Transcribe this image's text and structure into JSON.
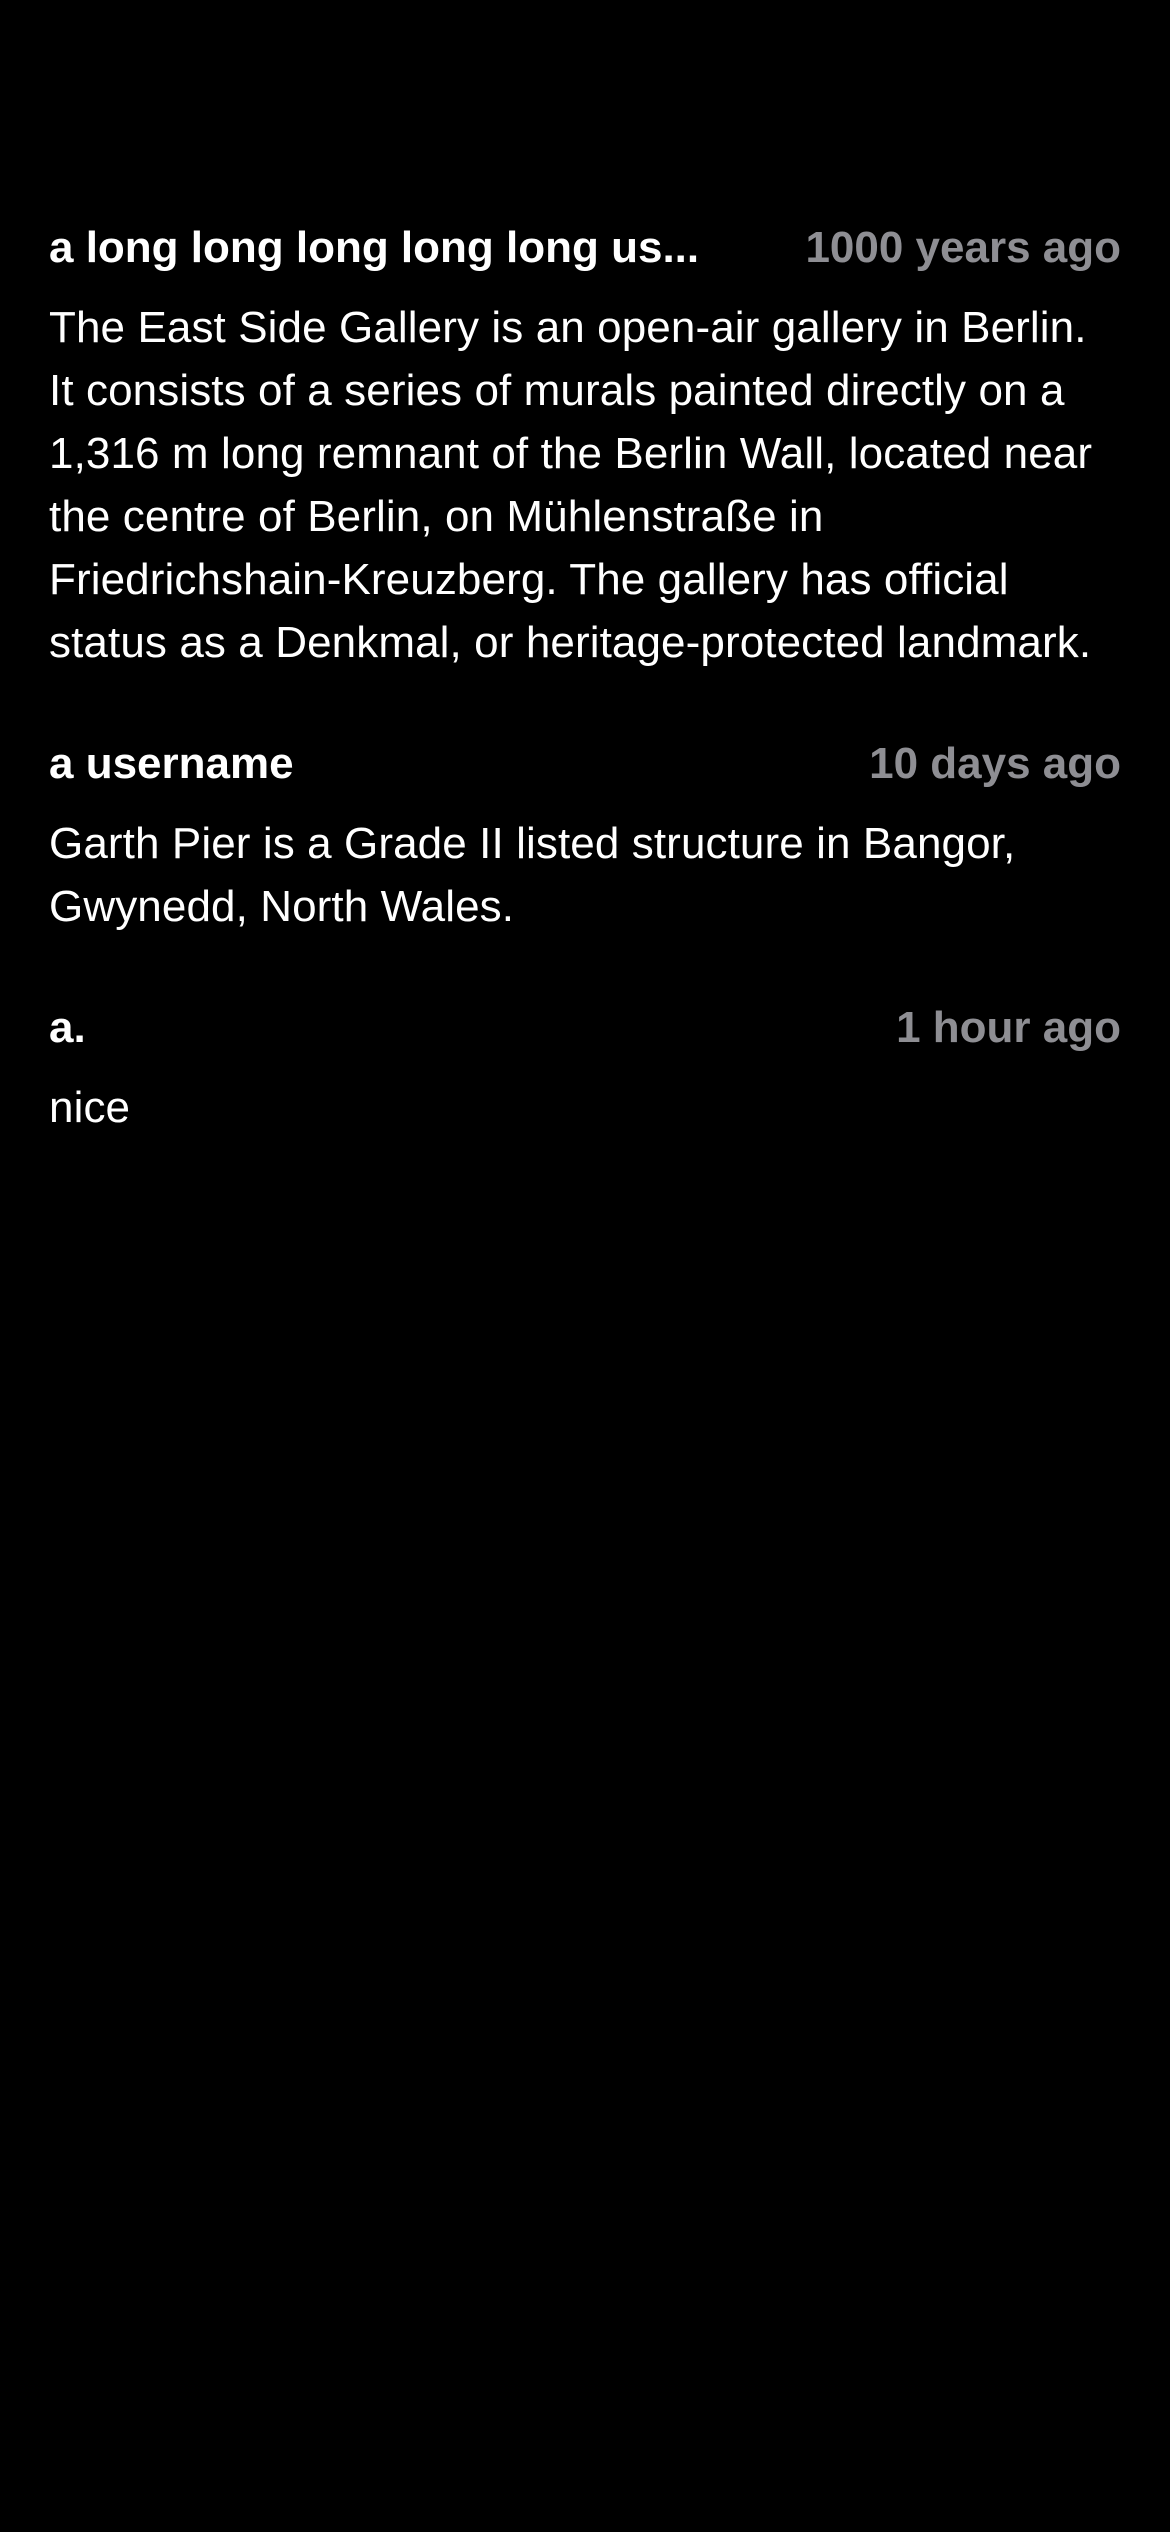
{
  "colors": {
    "background": "#000000",
    "username": "#ffffff",
    "timestamp": "#8e8e93",
    "body_text": "#ffffff"
  },
  "comments": [
    {
      "username": "a long long long long long us...",
      "timestamp": "1000 years ago",
      "body": "The East Side Gallery is an open-air gallery in Berlin. It consists of a series of murals painted directly on a 1,316 m long remnant of the Berlin Wall, located near the centre of Berlin, on Mühlenstraße in Friedrichshain-Kreuzberg. The gallery has official status as a Denkmal, or heritage-protected landmark."
    },
    {
      "username": "a username",
      "timestamp": "10 days ago",
      "body": "Garth Pier is a Grade II listed structure in Bangor, Gwynedd, North Wales."
    },
    {
      "username": "a.",
      "timestamp": "1 hour ago",
      "body": "nice"
    }
  ]
}
